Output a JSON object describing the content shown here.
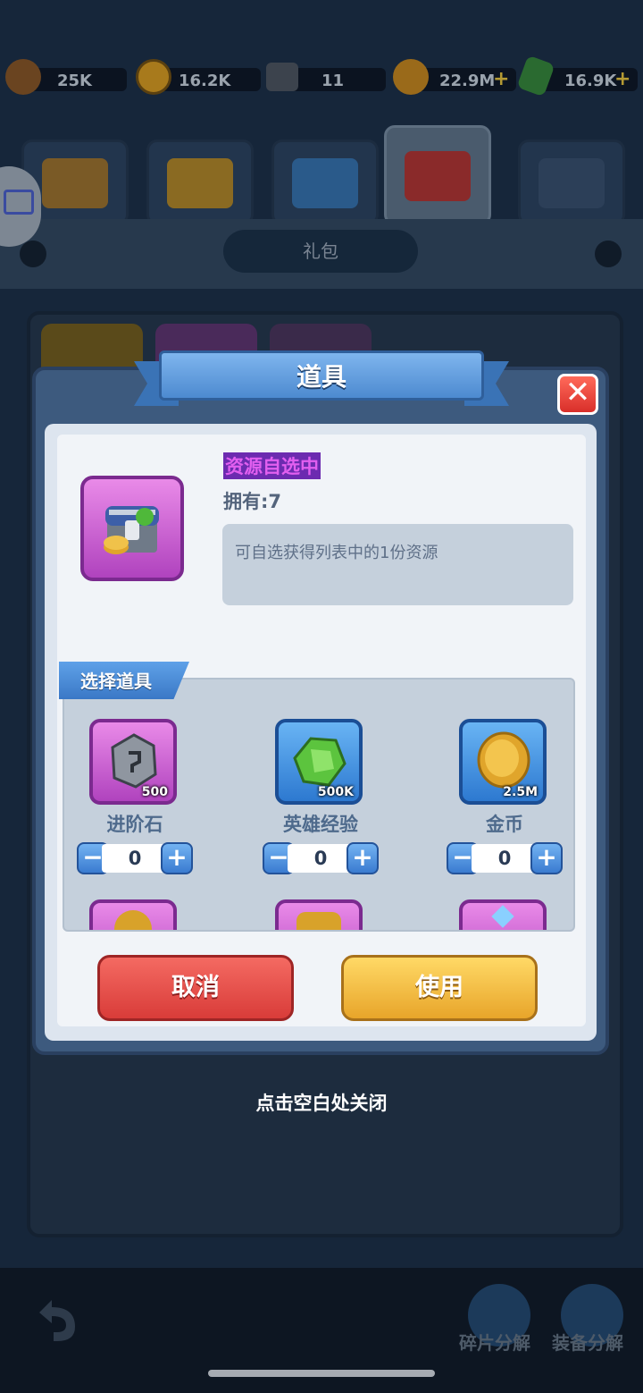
{
  "resources": [
    {
      "name": "wood",
      "value": "25K",
      "color": "#8a5a2b",
      "has_plus": false
    },
    {
      "name": "medal",
      "value": "16.2K",
      "color": "#d8a22a",
      "has_plus": false
    },
    {
      "name": "stone",
      "value": "11",
      "color": "#5c6470",
      "has_plus": false
    },
    {
      "name": "coin",
      "value": "22.9M",
      "color": "#e0a52b",
      "has_plus": true
    },
    {
      "name": "gem",
      "value": "16.9K",
      "color": "#3da44a",
      "has_plus": true
    }
  ],
  "resource_plus": "+",
  "header_label": "礼包",
  "modal": {
    "title": "道具",
    "close_symbol": "✕",
    "item_name": "资源自选中",
    "owned": "拥有:7",
    "description": "可自选获得列表中的1份资源",
    "select_label": "选择道具",
    "options": [
      {
        "name": "进阶石",
        "qty": "500",
        "count": "0",
        "frame": "purple",
        "icon": "rune-stone-icon"
      },
      {
        "name": "英雄经验",
        "qty": "500K",
        "count": "0",
        "frame": "blue",
        "icon": "exp-gem-icon"
      },
      {
        "name": "金币",
        "qty": "2.5M",
        "count": "0",
        "frame": "blue",
        "icon": "gold-coin-icon"
      }
    ],
    "minus_symbol": "−",
    "plus_symbol": "+",
    "cancel_label": "取消",
    "use_label": "使用"
  },
  "close_hint": "点击空白处关闭",
  "bottom": {
    "fragment_label": "碎片分解",
    "equip_label": "装备分解"
  },
  "colors": {
    "accent_blue": "#3a78c6",
    "cancel_red": "#d93c39",
    "use_gold": "#e8a52a",
    "item_purple": "#b043be"
  }
}
